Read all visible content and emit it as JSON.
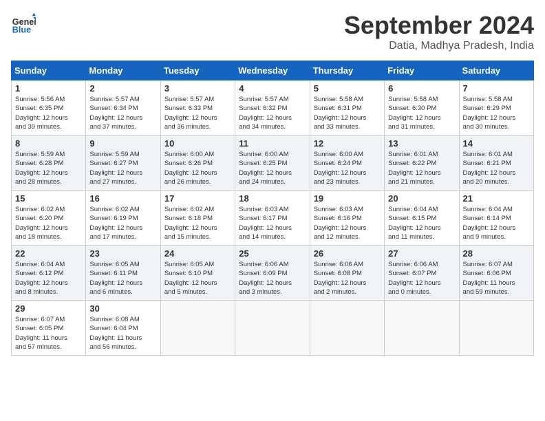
{
  "logo": {
    "line1": "General",
    "line2": "Blue"
  },
  "title": "September 2024",
  "subtitle": "Datia, Madhya Pradesh, India",
  "days_header": [
    "Sunday",
    "Monday",
    "Tuesday",
    "Wednesday",
    "Thursday",
    "Friday",
    "Saturday"
  ],
  "weeks": [
    {
      "bg": "light",
      "days": [
        {
          "num": "1",
          "sunrise": "5:56 AM",
          "sunset": "6:35 PM",
          "daylight": "12 hours and 39 minutes."
        },
        {
          "num": "2",
          "sunrise": "5:57 AM",
          "sunset": "6:34 PM",
          "daylight": "12 hours and 37 minutes."
        },
        {
          "num": "3",
          "sunrise": "5:57 AM",
          "sunset": "6:33 PM",
          "daylight": "12 hours and 36 minutes."
        },
        {
          "num": "4",
          "sunrise": "5:57 AM",
          "sunset": "6:32 PM",
          "daylight": "12 hours and 34 minutes."
        },
        {
          "num": "5",
          "sunrise": "5:58 AM",
          "sunset": "6:31 PM",
          "daylight": "12 hours and 33 minutes."
        },
        {
          "num": "6",
          "sunrise": "5:58 AM",
          "sunset": "6:30 PM",
          "daylight": "12 hours and 31 minutes."
        },
        {
          "num": "7",
          "sunrise": "5:58 AM",
          "sunset": "6:29 PM",
          "daylight": "12 hours and 30 minutes."
        }
      ]
    },
    {
      "bg": "alt",
      "days": [
        {
          "num": "8",
          "sunrise": "5:59 AM",
          "sunset": "6:28 PM",
          "daylight": "12 hours and 28 minutes."
        },
        {
          "num": "9",
          "sunrise": "5:59 AM",
          "sunset": "6:27 PM",
          "daylight": "12 hours and 27 minutes."
        },
        {
          "num": "10",
          "sunrise": "6:00 AM",
          "sunset": "6:26 PM",
          "daylight": "12 hours and 26 minutes."
        },
        {
          "num": "11",
          "sunrise": "6:00 AM",
          "sunset": "6:25 PM",
          "daylight": "12 hours and 24 minutes."
        },
        {
          "num": "12",
          "sunrise": "6:00 AM",
          "sunset": "6:24 PM",
          "daylight": "12 hours and 23 minutes."
        },
        {
          "num": "13",
          "sunrise": "6:01 AM",
          "sunset": "6:22 PM",
          "daylight": "12 hours and 21 minutes."
        },
        {
          "num": "14",
          "sunrise": "6:01 AM",
          "sunset": "6:21 PM",
          "daylight": "12 hours and 20 minutes."
        }
      ]
    },
    {
      "bg": "light",
      "days": [
        {
          "num": "15",
          "sunrise": "6:02 AM",
          "sunset": "6:20 PM",
          "daylight": "12 hours and 18 minutes."
        },
        {
          "num": "16",
          "sunrise": "6:02 AM",
          "sunset": "6:19 PM",
          "daylight": "12 hours and 17 minutes."
        },
        {
          "num": "17",
          "sunrise": "6:02 AM",
          "sunset": "6:18 PM",
          "daylight": "12 hours and 15 minutes."
        },
        {
          "num": "18",
          "sunrise": "6:03 AM",
          "sunset": "6:17 PM",
          "daylight": "12 hours and 14 minutes."
        },
        {
          "num": "19",
          "sunrise": "6:03 AM",
          "sunset": "6:16 PM",
          "daylight": "12 hours and 12 minutes."
        },
        {
          "num": "20",
          "sunrise": "6:04 AM",
          "sunset": "6:15 PM",
          "daylight": "12 hours and 11 minutes."
        },
        {
          "num": "21",
          "sunrise": "6:04 AM",
          "sunset": "6:14 PM",
          "daylight": "12 hours and 9 minutes."
        }
      ]
    },
    {
      "bg": "alt",
      "days": [
        {
          "num": "22",
          "sunrise": "6:04 AM",
          "sunset": "6:12 PM",
          "daylight": "12 hours and 8 minutes."
        },
        {
          "num": "23",
          "sunrise": "6:05 AM",
          "sunset": "6:11 PM",
          "daylight": "12 hours and 6 minutes."
        },
        {
          "num": "24",
          "sunrise": "6:05 AM",
          "sunset": "6:10 PM",
          "daylight": "12 hours and 5 minutes."
        },
        {
          "num": "25",
          "sunrise": "6:06 AM",
          "sunset": "6:09 PM",
          "daylight": "12 hours and 3 minutes."
        },
        {
          "num": "26",
          "sunrise": "6:06 AM",
          "sunset": "6:08 PM",
          "daylight": "12 hours and 2 minutes."
        },
        {
          "num": "27",
          "sunrise": "6:06 AM",
          "sunset": "6:07 PM",
          "daylight": "12 hours and 0 minutes."
        },
        {
          "num": "28",
          "sunrise": "6:07 AM",
          "sunset": "6:06 PM",
          "daylight": "11 hours and 59 minutes."
        }
      ]
    },
    {
      "bg": "light",
      "days": [
        {
          "num": "29",
          "sunrise": "6:07 AM",
          "sunset": "6:05 PM",
          "daylight": "11 hours and 57 minutes."
        },
        {
          "num": "30",
          "sunrise": "6:08 AM",
          "sunset": "6:04 PM",
          "daylight": "11 hours and 56 minutes."
        },
        null,
        null,
        null,
        null,
        null
      ]
    }
  ]
}
